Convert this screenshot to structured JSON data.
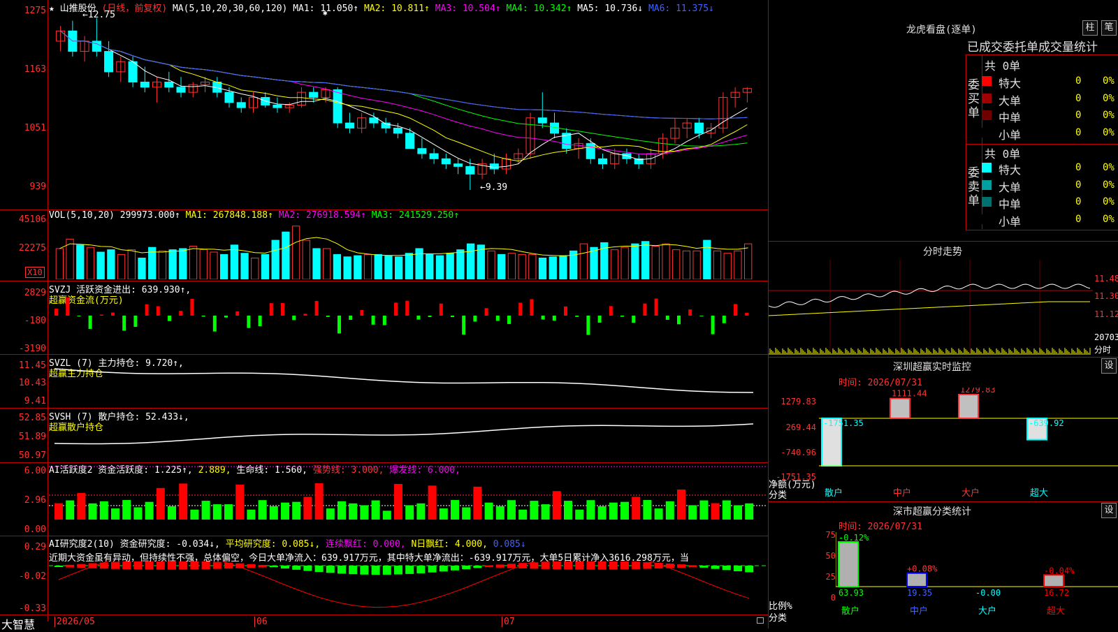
{
  "title": {
    "star": "★",
    "stock": "山推股份",
    "mode": "(日线，前复权)"
  },
  "ma_header": {
    "label": "MA(5,10,20,30,60,120)",
    "ma1": "MA1: 11.050↑",
    "ma2": "MA2: 10.811↑",
    "ma3": "MA3: 10.504↑",
    "ma4": "MA4: 10.342↑",
    "ma5": "MA5: 10.736↓",
    "ma6": "MA6: 11.375↓"
  },
  "price_axis": [
    "1275",
    "1163",
    "1051",
    "939"
  ],
  "price_marks": {
    "high": "←12.75",
    "low": "←9.39",
    "asterisk": "✱"
  },
  "vol_header": {
    "label": "VOL(5,10,20)",
    "val": "299973.000↑",
    "ma1": "MA1: 267848.188↑",
    "ma2": "MA2: 276918.594↑",
    "ma3": "MA3: 241529.250↑"
  },
  "vol_axis": [
    "45106",
    "22275"
  ],
  "vol_unit": "X10",
  "svzj": {
    "line1": "SVZJ  活跃资金进出: 639.930↑,",
    "line2": "超赢资金流(万元)",
    "axis": [
      "2829",
      "-180",
      "-3190"
    ]
  },
  "svzl": {
    "line1": "SVZL (7) 主力持仓: 9.720↑,",
    "line2": "超赢主力持仓",
    "axis": [
      "11.45",
      "10.43",
      "9.41"
    ]
  },
  "svsh": {
    "line1": "SVSH (7) 散户持仓: 52.433↓,",
    "line2": "超赢散户持仓",
    "axis": [
      "52.85",
      "51.89",
      "50.97"
    ]
  },
  "ai1": {
    "a": "AI活跃度2 资金活跃度: 1.225↑,",
    "b": "2.889,",
    "c": "生命线: 1.560,",
    "d": "强势线: 3.000,",
    "e": "爆发线: 6.000,",
    "axis": [
      "6.00",
      "2.96",
      "0.00"
    ]
  },
  "ai2": {
    "a": "AI研究度2(10) 资金研究度: -0.034↓,",
    "b": "平均研究度: 0.085↓,",
    "c": "连续飘红: 0.000,",
    "d": "N日飘红: 4.000,",
    "e": "0.085↓",
    "text": "近期大资金虽有异动，但持续性不强，总体偏空，今日大单净流入：639.917万元，其中特大单净流出：-639.917万元，大单5日累计净入3616.298万元，当",
    "axis": [
      "0.29",
      "-0.02",
      "-0.33"
    ]
  },
  "date_axis": {
    "left_brand": "大智慧",
    "d1": "2026/05",
    "d2": "06",
    "d3": "07"
  },
  "longhu": {
    "title": "龙虎看盘(逐单)",
    "btn1": "柱",
    "btn2": "笔",
    "subtitle": "已成交委托单成交量统计",
    "buy": {
      "side": "委买单",
      "total": "共 0单",
      "rows": [
        {
          "label": "特大",
          "n": "0",
          "p": "0%",
          "color": "#ff0000"
        },
        {
          "label": "大单",
          "n": "0",
          "p": "0%",
          "color": "#a00000"
        },
        {
          "label": "中单",
          "n": "0",
          "p": "0%",
          "color": "#700000"
        },
        {
          "label": "小单",
          "n": "0",
          "p": "0%",
          "color": "#000000"
        }
      ]
    },
    "sell": {
      "side": "委卖单",
      "total": "共 0单",
      "rows": [
        {
          "label": "特大",
          "n": "0",
          "p": "0%",
          "color": "#00ffff"
        },
        {
          "label": "大单",
          "n": "0",
          "p": "0%",
          "color": "#00a0a0"
        },
        {
          "label": "中单",
          "n": "0",
          "p": "0%",
          "color": "#007070"
        },
        {
          "label": "小单",
          "n": "0",
          "p": "0%",
          "color": "#000000"
        }
      ]
    }
  },
  "intraday": {
    "title": "分时走势",
    "axis": [
      "11.48",
      "11.30",
      "11.12"
    ],
    "vol": "20703",
    "unit": "分时"
  },
  "sz_monitor": {
    "title": "深圳超赢实时监控",
    "btn": "设",
    "time": "时间: 2026/07/31",
    "axis": [
      "1279.83",
      "269.44",
      "-740.96",
      "-1751.35"
    ],
    "bars": [
      {
        "cat": "散户",
        "value": -1751.35,
        "label": "-1751.35"
      },
      {
        "cat": "中户",
        "value": 1111.44,
        "label": "1111.44"
      },
      {
        "cat": "大户",
        "value": 1279.83,
        "label": "1279.83"
      },
      {
        "cat": "超大",
        "value": -639.92,
        "label": "-639.92"
      }
    ],
    "yname": "净额(万元)",
    "xname": "分类"
  },
  "sz_stats": {
    "title": "深市超赢分类统计",
    "btn": "设",
    "time": "时间: 2026/07/31",
    "axis": [
      "75",
      "50",
      "25",
      "0"
    ],
    "bars": [
      {
        "cat": "散户",
        "value": 63.93,
        "top": "-0.12%",
        "bottom": "63.93",
        "color": "#00ff00"
      },
      {
        "cat": "中户",
        "value": 19.35,
        "top": "+0.08%",
        "bottom": "19.35",
        "color": "#0000ff"
      },
      {
        "cat": "大户",
        "value": 0,
        "top": "",
        "bottom": "-0.00",
        "color": "#00ffff"
      },
      {
        "cat": "超大",
        "value": 16.72,
        "top": "-0.04%",
        "bottom": "16.72",
        "color": "#ff0000"
      }
    ],
    "yname": "比例%",
    "xname": "分类"
  },
  "chart_data": [
    {
      "type": "candlestick",
      "title": "山推股份 (日线，前复权)",
      "ylim": [
        9.39,
        12.75
      ],
      "x": [
        "2026/05",
        "06",
        "07"
      ],
      "ohlc": [
        [
          12.3,
          12.6,
          12.1,
          12.5
        ],
        [
          12.5,
          12.7,
          12.0,
          12.1
        ],
        [
          12.1,
          12.4,
          11.9,
          12.3
        ],
        [
          12.3,
          12.75,
          12.0,
          12.1
        ],
        [
          12.1,
          12.3,
          11.6,
          11.7
        ],
        [
          11.7,
          12.0,
          11.5,
          11.9
        ],
        [
          11.9,
          12.0,
          11.4,
          11.5
        ],
        [
          11.5,
          11.8,
          11.3,
          11.4
        ],
        [
          11.4,
          11.6,
          11.1,
          11.5
        ],
        [
          11.5,
          11.7,
          11.3,
          11.4
        ],
        [
          11.4,
          11.6,
          11.2,
          11.3
        ],
        [
          11.3,
          11.5,
          11.2,
          11.45
        ],
        [
          11.45,
          11.6,
          11.3,
          11.5
        ],
        [
          11.5,
          11.6,
          11.2,
          11.3
        ],
        [
          11.3,
          11.4,
          11.0,
          11.1
        ],
        [
          11.1,
          11.2,
          10.9,
          11.0
        ],
        [
          11.0,
          11.3,
          10.9,
          11.2
        ],
        [
          11.2,
          11.3,
          11.0,
          11.05
        ],
        [
          11.05,
          11.2,
          10.9,
          11.0
        ],
        [
          11.0,
          11.1,
          10.9,
          11.05
        ],
        [
          11.05,
          11.4,
          11.0,
          11.3
        ],
        [
          11.3,
          11.4,
          11.1,
          11.2
        ],
        [
          11.2,
          11.4,
          11.1,
          11.35
        ],
        [
          11.35,
          11.4,
          10.6,
          10.7
        ],
        [
          10.7,
          10.9,
          10.5,
          10.6
        ],
        [
          10.6,
          10.9,
          10.5,
          10.8
        ],
        [
          10.8,
          10.9,
          10.6,
          10.7
        ],
        [
          10.7,
          10.8,
          10.5,
          10.6
        ],
        [
          10.6,
          10.7,
          10.4,
          10.5
        ],
        [
          10.5,
          10.6,
          10.3,
          10.2
        ],
        [
          10.2,
          10.4,
          10.0,
          10.1
        ],
        [
          10.1,
          10.2,
          9.9,
          10.0
        ],
        [
          10.0,
          10.1,
          9.8,
          9.9
        ],
        [
          9.9,
          10.0,
          9.7,
          9.85
        ],
        [
          9.85,
          10.0,
          9.39,
          9.7
        ],
        [
          9.7,
          10.0,
          9.6,
          9.9
        ],
        [
          9.9,
          10.1,
          9.7,
          9.8
        ],
        [
          9.8,
          10.1,
          9.7,
          10.0
        ],
        [
          10.0,
          10.2,
          9.9,
          10.1
        ],
        [
          10.1,
          10.9,
          10.0,
          10.8
        ],
        [
          10.8,
          11.3,
          10.6,
          10.7
        ],
        [
          10.7,
          10.9,
          10.4,
          10.5
        ],
        [
          10.5,
          10.6,
          10.1,
          10.2
        ],
        [
          10.2,
          10.4,
          10.0,
          10.3
        ],
        [
          10.3,
          10.4,
          9.9,
          10.0
        ],
        [
          10.0,
          10.1,
          9.8,
          9.9
        ],
        [
          9.9,
          10.2,
          9.8,
          10.1
        ],
        [
          10.1,
          10.2,
          9.9,
          10.0
        ],
        [
          10.0,
          10.1,
          9.8,
          9.9
        ],
        [
          9.9,
          10.2,
          9.8,
          10.1
        ],
        [
          10.1,
          10.5,
          10.0,
          10.4
        ],
        [
          10.4,
          10.8,
          10.3,
          10.6
        ],
        [
          10.6,
          10.8,
          10.4,
          10.7
        ],
        [
          10.7,
          10.8,
          10.4,
          10.5
        ],
        [
          10.5,
          10.7,
          10.4,
          10.6
        ],
        [
          10.6,
          11.3,
          10.5,
          11.2
        ],
        [
          11.2,
          11.4,
          11.0,
          11.3
        ],
        [
          11.3,
          11.4,
          11.1,
          11.375
        ]
      ]
    },
    {
      "type": "bar",
      "title": "VOL(5,10,20)",
      "values": [
        26,
        34,
        29,
        27,
        23,
        25,
        21,
        25,
        18,
        27,
        24,
        25,
        26,
        28,
        25,
        23,
        21,
        29,
        22,
        18,
        21,
        33,
        40,
        45,
        33,
        26,
        26,
        21,
        19,
        20,
        21,
        21,
        20,
        19,
        22,
        26,
        21,
        20,
        22,
        25,
        30,
        29,
        24,
        21,
        22,
        21,
        21,
        18,
        19,
        20,
        24,
        30,
        27,
        31,
        25,
        27,
        30,
        32,
        28,
        30,
        25,
        24,
        24,
        33,
        24,
        22,
        24,
        30
      ]
    },
    {
      "type": "bar",
      "title": "活跃资金进出",
      "values": [
        639.93
      ]
    },
    {
      "type": "bar",
      "title": "深圳超赢实时监控",
      "categories": [
        "散户",
        "中户",
        "大户",
        "超大"
      ],
      "values": [
        -1751.35,
        1111.44,
        1279.83,
        -639.92
      ],
      "ylabel": "净额(万元)",
      "xlabel": "分类",
      "ylim": [
        -1751.35,
        1279.83
      ]
    },
    {
      "type": "bar",
      "title": "深市超赢分类统计",
      "categories": [
        "散户",
        "中户",
        "大户",
        "超大"
      ],
      "values": [
        63.93,
        19.35,
        0,
        16.72
      ],
      "ylabel": "比例%",
      "xlabel": "分类",
      "ylim": [
        0,
        75
      ]
    }
  ],
  "colors": {
    "up": "#ff3333",
    "down": "#00ffff",
    "grid": "#c00000",
    "ma1": "#ffffff",
    "ma2": "#ffff00",
    "ma3": "#ff00ff",
    "ma4": "#00ff00",
    "ma5": "#c0c0c0",
    "ma6": "#4060ff"
  }
}
